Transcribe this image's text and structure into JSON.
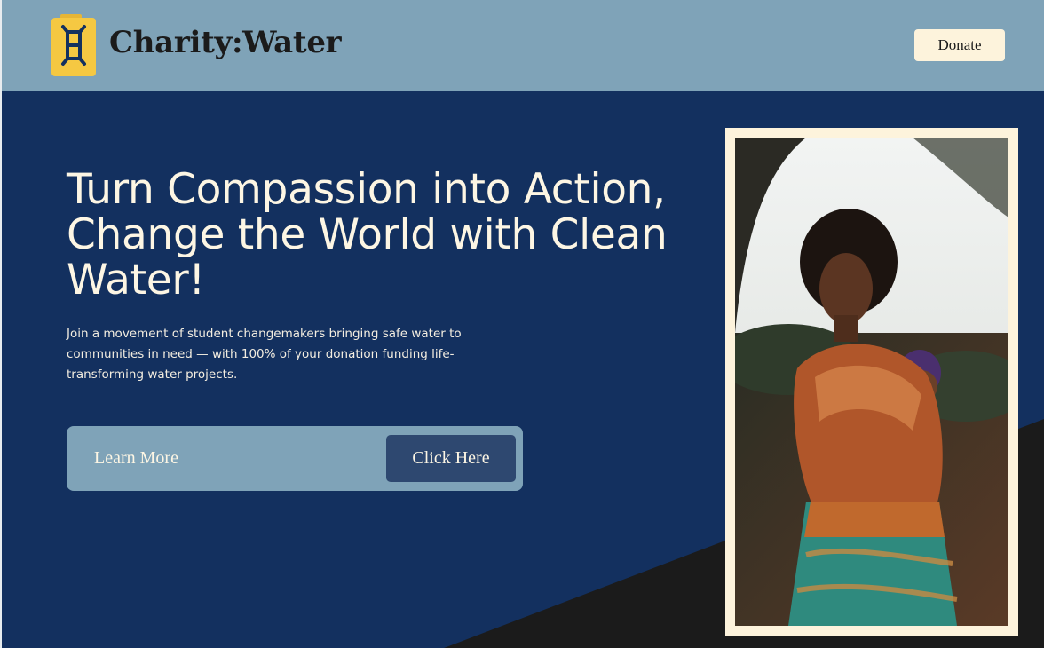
{
  "header": {
    "brand": "Charity:Water",
    "donate_label": "Donate",
    "logo_icon": "jerry-can-icon",
    "logo_color": "#f5c842"
  },
  "hero": {
    "headline": "Turn Compassion into Action, Change the World with Clean Water!",
    "subtext": "Join a movement of student changemakers bringing safe water to communities in need — with 100% of your donation funding life-transforming water projects.",
    "learn_more_label": "Learn More",
    "click_here_label": "Click Here"
  },
  "colors": {
    "header_bg": "#7fa3b8",
    "hero_bg": "#13305f",
    "accent_cream": "#fdf3dc",
    "button_dark": "#2e4870",
    "diagonal_dark": "#1b1b1b"
  }
}
